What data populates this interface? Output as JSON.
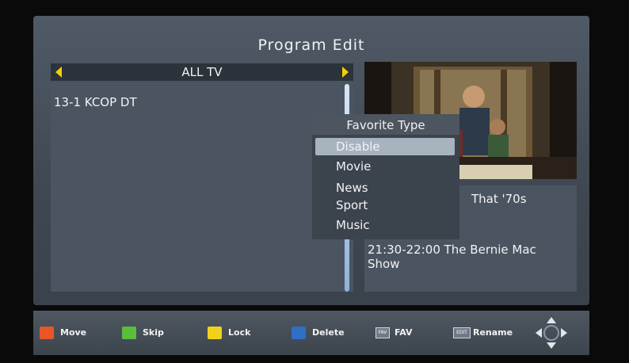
{
  "screen": {
    "title": "Program Edit"
  },
  "list": {
    "group": "ALL TV",
    "channels": [
      "13-1 KCOP DT"
    ]
  },
  "epg": {
    "line1": "That '70s",
    "line2": "21:30-22:00  The Bernie Mac Show"
  },
  "popup": {
    "title": "Favorite Type",
    "options": [
      "Disable",
      "Movie",
      "News",
      "Sport",
      "Music"
    ],
    "selected": "Disable"
  },
  "footer": {
    "keys": [
      {
        "label": "Move",
        "color": "#e8562a"
      },
      {
        "label": "Skip",
        "color": "#5cbc3c"
      },
      {
        "label": "Lock",
        "color": "#f1d21a"
      },
      {
        "label": "Delete",
        "color": "#2f6fc6"
      },
      {
        "label": "FAV",
        "icon": "fav-icon"
      },
      {
        "label": "Rename",
        "icon": "rename-icon"
      }
    ],
    "nav_icon": "dpad-icon"
  },
  "colors": {
    "panel": "#4a5561",
    "highlight": "#a8b3c0",
    "arrow": "#f4d000"
  }
}
